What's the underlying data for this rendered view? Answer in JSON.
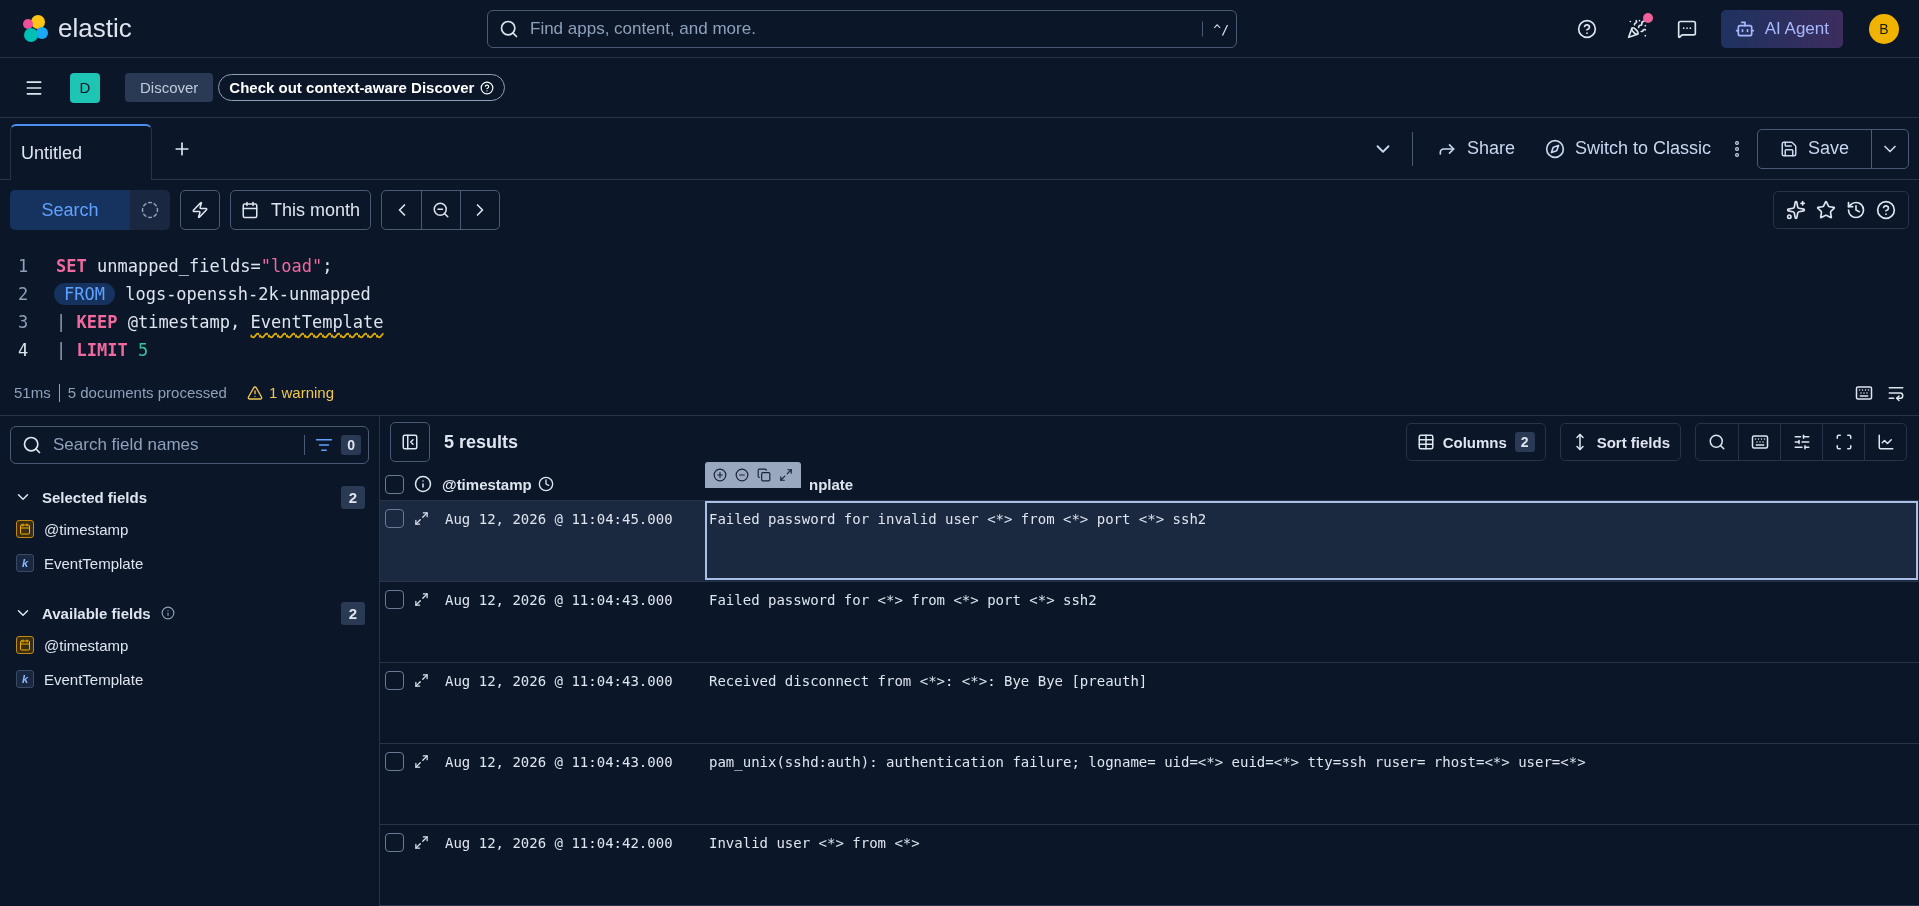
{
  "header": {
    "logo": "elastic",
    "search": {
      "placeholder": "Find apps, content, and more.",
      "shortcut": "^/"
    },
    "notification": true,
    "ai_agent": "AI Agent",
    "avatar": "B"
  },
  "breadcrumbs": {
    "app_badge": "D",
    "current": "Discover",
    "callout": "Check out context-aware Discover"
  },
  "tabs": [
    {
      "label": "Untitled",
      "selected": true
    }
  ],
  "actions": {
    "share": "Share",
    "switch": "Switch to Classic",
    "save": "Save"
  },
  "query_bar": {
    "search_button": "Search",
    "date": "This month"
  },
  "editor": {
    "lines": [
      {
        "number": "1",
        "current": false,
        "tokens": [
          {
            "kind": "keyword",
            "text": "SET"
          },
          {
            "kind": "plain",
            "text": " unmapped_fields="
          },
          {
            "kind": "string",
            "text": "\"load\""
          },
          {
            "kind": "plain",
            "text": ";"
          }
        ]
      },
      {
        "number": "2",
        "current": false,
        "tokens": [
          {
            "kind": "source",
            "text": "FROM"
          },
          {
            "kind": "plain",
            "text": " logs-openssh-2k-unmapped"
          }
        ]
      },
      {
        "number": "3",
        "current": false,
        "tokens": [
          {
            "kind": "pipe",
            "text": "| "
          },
          {
            "kind": "keyword",
            "text": "KEEP"
          },
          {
            "kind": "plain",
            "text": " @timestamp, "
          },
          {
            "kind": "warning",
            "text": "EventTemplate"
          }
        ]
      },
      {
        "number": "4",
        "current": true,
        "tokens": [
          {
            "kind": "pipe",
            "text": "| "
          },
          {
            "kind": "keyword",
            "text": "LIMIT"
          },
          {
            "kind": "number",
            "text": " 5"
          }
        ]
      }
    ]
  },
  "status": {
    "duration": "51ms",
    "documents": "5 documents processed",
    "warning": "1 warning"
  },
  "sidebar": {
    "search": {
      "placeholder": "Search field names"
    },
    "filter_count": "0",
    "groups": [
      {
        "title": "Selected fields",
        "count": "2",
        "expanded": true,
        "fields": [
          {
            "name": "@timestamp",
            "kind": "date"
          },
          {
            "name": "EventTemplate",
            "kind": "keyword",
            "glyph": "k"
          }
        ]
      },
      {
        "title": "Available fields",
        "count": "2",
        "expanded": true,
        "info": true,
        "fields": [
          {
            "name": "@timestamp",
            "kind": "date"
          },
          {
            "name": "EventTemplate",
            "kind": "keyword",
            "glyph": "k"
          }
        ]
      }
    ]
  },
  "grid": {
    "result_count": "5 results",
    "columns_button": "Columns",
    "columns_count": "2",
    "sort_button": "Sort fields",
    "select_all_checked": false,
    "columns": [
      {
        "label": "@timestamp"
      },
      {
        "label": "nplate"
      }
    ],
    "rows": [
      {
        "selected": true,
        "checked": false,
        "timestamp": "Aug 12, 2026 @ 11:04:45.000",
        "event": "Failed password for invalid user <*> from <*> port <*> ssh2"
      },
      {
        "selected": false,
        "checked": false,
        "timestamp": "Aug 12, 2026 @ 11:04:43.000",
        "event": "Failed password for <*> from <*> port <*> ssh2"
      },
      {
        "selected": false,
        "checked": false,
        "timestamp": "Aug 12, 2026 @ 11:04:43.000",
        "event": "Received disconnect from <*>: <*>: Bye Bye [preauth]"
      },
      {
        "selected": false,
        "checked": false,
        "timestamp": "Aug 12, 2026 @ 11:04:43.000",
        "event": "pam_unix(sshd:auth): authentication failure; logname= uid=<*> euid=<*> tty=ssh ruser= rhost=<*> user=<*>"
      },
      {
        "selected": false,
        "checked": false,
        "timestamp": "Aug 12, 2026 @ 11:04:42.000",
        "event": "Invalid user <*> from <*>"
      }
    ]
  }
}
